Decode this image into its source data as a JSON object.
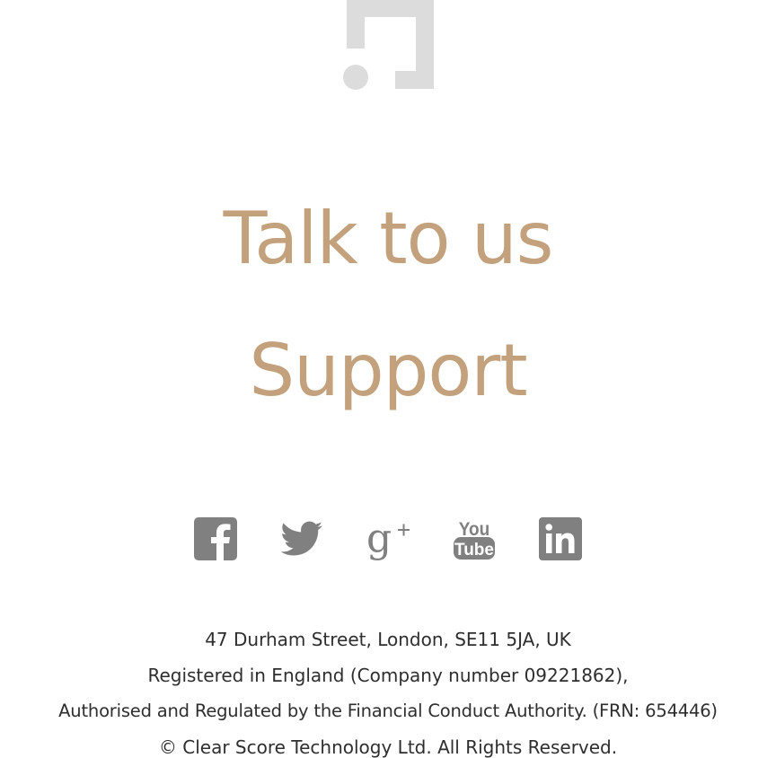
{
  "colors": {
    "accent": "#c2a17c",
    "icon": "#808080",
    "logo": "#dcdcdc",
    "text": "#2e2e2e"
  },
  "logo": {
    "icon": "clearscore-logo-icon"
  },
  "links": {
    "talk_to_us": "Talk to us",
    "support": "Support"
  },
  "social": [
    {
      "name": "facebook",
      "icon": "facebook-icon"
    },
    {
      "name": "twitter",
      "icon": "twitter-icon"
    },
    {
      "name": "google-plus",
      "icon": "google-plus-icon"
    },
    {
      "name": "youtube",
      "icon": "youtube-icon"
    },
    {
      "name": "linkedin",
      "icon": "linkedin-icon"
    }
  ],
  "footer": {
    "address": "47 Durham Street, London, SE11 5JA, UK",
    "registration": "Registered in England (Company number 09221862),",
    "regulation": "Authorised and Regulated by the Financial Conduct Authority. (FRN: 654446)",
    "copyright": "© Clear Score Technology Ltd. All Rights Reserved."
  }
}
